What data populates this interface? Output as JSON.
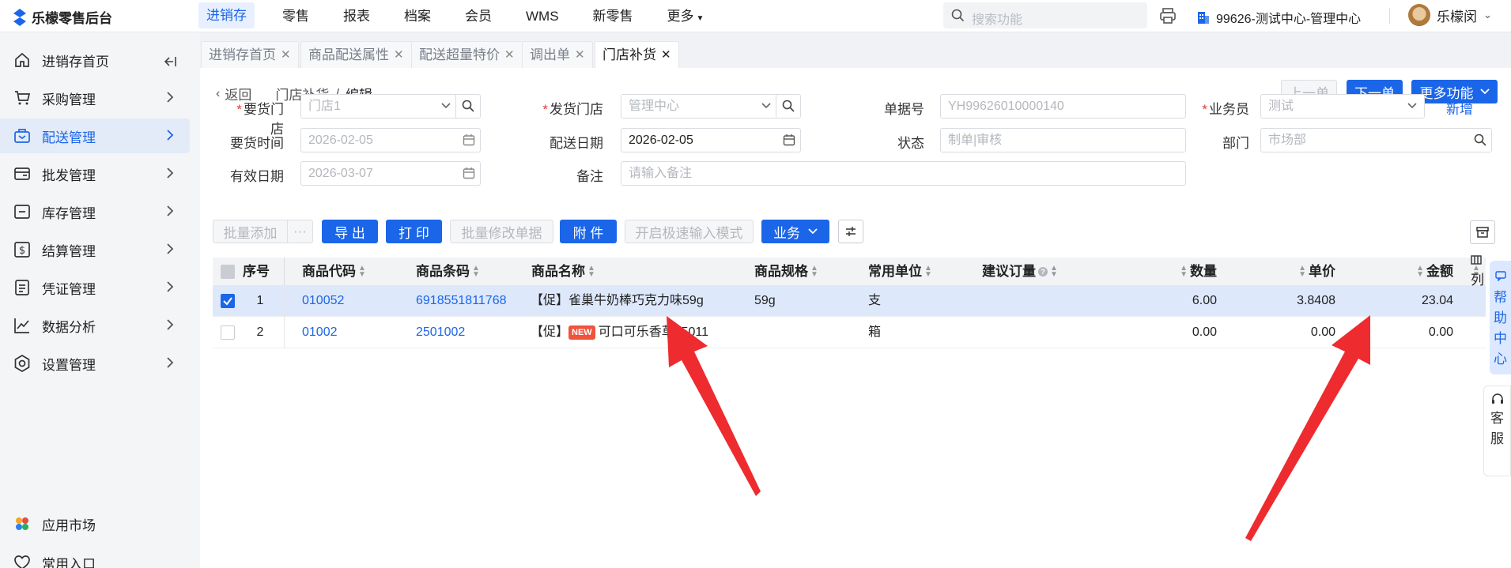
{
  "app": {
    "title": "乐檬零售后台"
  },
  "topnav": {
    "items": [
      "进销存",
      "零售",
      "报表",
      "档案",
      "会员",
      "WMS",
      "新零售",
      "更多"
    ],
    "search_placeholder": "搜索功能",
    "tenant": "99626-测试中心-管理中心",
    "user": "乐檬闵"
  },
  "sidebar": {
    "items": [
      {
        "label": "进销存首页",
        "icon": "home-icon"
      },
      {
        "label": "采购管理",
        "icon": "cart-icon"
      },
      {
        "label": "配送管理",
        "icon": "delivery-icon"
      },
      {
        "label": "批发管理",
        "icon": "wholesale-icon"
      },
      {
        "label": "库存管理",
        "icon": "inventory-icon"
      },
      {
        "label": "结算管理",
        "icon": "settlement-icon"
      },
      {
        "label": "凭证管理",
        "icon": "voucher-icon"
      },
      {
        "label": "数据分析",
        "icon": "chart-icon"
      },
      {
        "label": "设置管理",
        "icon": "settings-icon"
      }
    ],
    "bottom": [
      {
        "label": "应用市场",
        "icon": "app-market-icon"
      },
      {
        "label": "常用入口",
        "icon": "heart-icon"
      }
    ]
  },
  "tabs": [
    "进销存首页",
    "商品配送属性",
    "配送超量特价",
    "调出单",
    "门店补货"
  ],
  "breadcrumb": {
    "back": "返回",
    "parent": "门店补货",
    "current": "编辑"
  },
  "nav_buttons": {
    "prev": "上一单",
    "next": "下一单",
    "more": "更多功能"
  },
  "form": {
    "request_store": {
      "label": "要货门店",
      "placeholder": "门店1"
    },
    "ship_store": {
      "label": "发货门店",
      "placeholder": "管理中心"
    },
    "doc_no": {
      "label": "单据号",
      "placeholder": "YH99626010000140"
    },
    "salesman": {
      "label": "业务员",
      "placeholder": "测试",
      "add": "新增"
    },
    "request_time": {
      "label": "要货时间",
      "placeholder": "2026-02-05"
    },
    "delivery_date": {
      "label": "配送日期",
      "value": "2026-02-05"
    },
    "status": {
      "label": "状态",
      "placeholder": "制单|审核"
    },
    "dept": {
      "label": "部门",
      "placeholder": "市场部"
    },
    "valid_date": {
      "label": "有效日期",
      "placeholder": "2026-03-07"
    },
    "remark": {
      "label": "备注",
      "placeholder": "请输入备注"
    }
  },
  "toolbar": {
    "batch_add": "批量添加",
    "more_dots": "···",
    "export": "导 出",
    "print": "打 印",
    "batch_edit": "批量修改单据",
    "attach": "附 件",
    "quick_input": "开启极速输入模式",
    "business": "业务"
  },
  "table": {
    "headers": [
      "序号",
      "商品代码",
      "商品条码",
      "商品名称",
      "商品规格",
      "常用单位",
      "建议订量",
      "数量",
      "单价",
      "金额"
    ],
    "rows": [
      {
        "idx": "1",
        "code": "010052",
        "barcode": "6918551811768",
        "tag": "【促】",
        "name": "雀巢牛奶棒巧克力味59g",
        "spec": "59g",
        "unit": "支",
        "qty": "6.00",
        "price": "3.8408",
        "amount": "23.04",
        "selected": true,
        "isNew": false
      },
      {
        "idx": "2",
        "code": "01002",
        "barcode": "2501002",
        "tag": "【促】",
        "badge": "NEW",
        "name": "可口可乐香草55011",
        "spec": "",
        "unit": "箱",
        "qty": "0.00",
        "price": "0.00",
        "amount": "0.00",
        "selected": false,
        "isNew": true
      }
    ]
  },
  "floating": {
    "help": [
      "帮",
      "助",
      "中",
      "心"
    ],
    "cs": [
      "客",
      "服"
    ],
    "cols": "列"
  },
  "colors": {
    "accent": "#1b66e8",
    "arrow": "#ee2b2f",
    "selectedRow": "#dde8fb"
  }
}
